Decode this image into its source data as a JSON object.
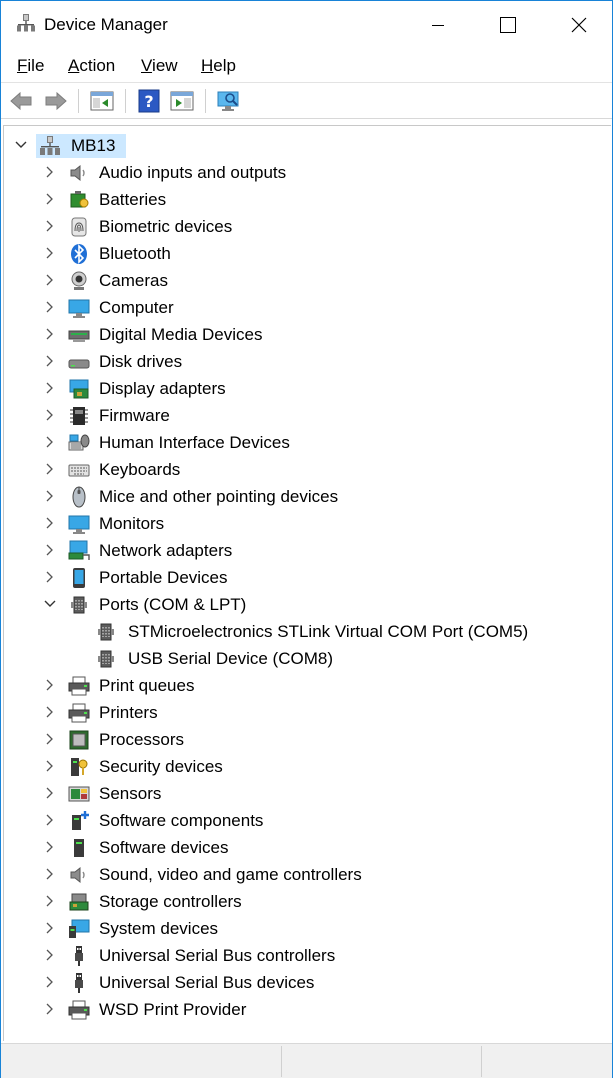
{
  "window": {
    "title": "Device Manager"
  },
  "menu": [
    {
      "label": "File",
      "accel": "F",
      "rest": "ile"
    },
    {
      "label": "Action",
      "accel": "A",
      "rest": "ction"
    },
    {
      "label": "View",
      "accel": "V",
      "rest": "iew"
    },
    {
      "label": "Help",
      "accel": "H",
      "rest": "elp"
    }
  ],
  "toolbar": [
    {
      "name": "back-arrow-icon",
      "enabled": false
    },
    {
      "name": "forward-arrow-icon",
      "enabled": false
    },
    {
      "name": "show-hide-console-tree-icon",
      "enabled": true
    },
    {
      "name": "help-icon",
      "enabled": true
    },
    {
      "name": "show-hide-action-pane-icon",
      "enabled": true
    },
    {
      "name": "scan-hardware-monitor-icon",
      "enabled": true
    }
  ],
  "tree": {
    "root": {
      "label": "MB13",
      "expanded": true,
      "selected": true
    },
    "categories": [
      {
        "label": "Audio inputs and outputs",
        "icon": "speaker-icon",
        "expanded": false
      },
      {
        "label": "Batteries",
        "icon": "battery-icon",
        "expanded": false
      },
      {
        "label": "Biometric devices",
        "icon": "fingerprint-icon",
        "expanded": false
      },
      {
        "label": "Bluetooth",
        "icon": "bluetooth-icon",
        "expanded": false
      },
      {
        "label": "Cameras",
        "icon": "camera-icon",
        "expanded": false
      },
      {
        "label": "Computer",
        "icon": "computer-icon",
        "expanded": false
      },
      {
        "label": "Digital Media Devices",
        "icon": "media-device-icon",
        "expanded": false
      },
      {
        "label": "Disk drives",
        "icon": "disk-drive-icon",
        "expanded": false
      },
      {
        "label": "Display adapters",
        "icon": "display-adapter-icon",
        "expanded": false
      },
      {
        "label": "Firmware",
        "icon": "firmware-chip-icon",
        "expanded": false
      },
      {
        "label": "Human Interface Devices",
        "icon": "hid-icon",
        "expanded": false
      },
      {
        "label": "Keyboards",
        "icon": "keyboard-icon",
        "expanded": false
      },
      {
        "label": "Mice and other pointing devices",
        "icon": "mouse-icon",
        "expanded": false
      },
      {
        "label": "Monitors",
        "icon": "monitor-icon",
        "expanded": false
      },
      {
        "label": "Network adapters",
        "icon": "network-adapter-icon",
        "expanded": false
      },
      {
        "label": "Portable Devices",
        "icon": "portable-device-icon",
        "expanded": false
      },
      {
        "label": "Ports (COM & LPT)",
        "icon": "port-icon",
        "expanded": true,
        "children": [
          {
            "label": "STMicroelectronics STLink Virtual COM Port (COM5)",
            "icon": "port-icon"
          },
          {
            "label": "USB Serial Device (COM8)",
            "icon": "port-icon"
          }
        ]
      },
      {
        "label": "Print queues",
        "icon": "printer-icon",
        "expanded": false
      },
      {
        "label": "Printers",
        "icon": "printer-icon",
        "expanded": false
      },
      {
        "label": "Processors",
        "icon": "processor-icon",
        "expanded": false
      },
      {
        "label": "Security devices",
        "icon": "security-key-icon",
        "expanded": false
      },
      {
        "label": "Sensors",
        "icon": "sensor-icon",
        "expanded": false
      },
      {
        "label": "Software components",
        "icon": "software-component-icon",
        "expanded": false
      },
      {
        "label": "Software devices",
        "icon": "software-device-icon",
        "expanded": false
      },
      {
        "label": "Sound, video and game controllers",
        "icon": "speaker-icon",
        "expanded": false
      },
      {
        "label": "Storage controllers",
        "icon": "storage-controller-icon",
        "expanded": false
      },
      {
        "label": "System devices",
        "icon": "system-device-icon",
        "expanded": false
      },
      {
        "label": "Universal Serial Bus controllers",
        "icon": "usb-icon",
        "expanded": false
      },
      {
        "label": "Universal Serial Bus devices",
        "icon": "usb-icon",
        "expanded": false
      },
      {
        "label": "WSD Print Provider",
        "icon": "printer-icon",
        "expanded": false
      }
    ]
  },
  "colors": {
    "selection": "#cce8ff",
    "accent": "#1883d7",
    "bluetooth": "#1f6fd6",
    "monitor": "#38a7e6"
  }
}
